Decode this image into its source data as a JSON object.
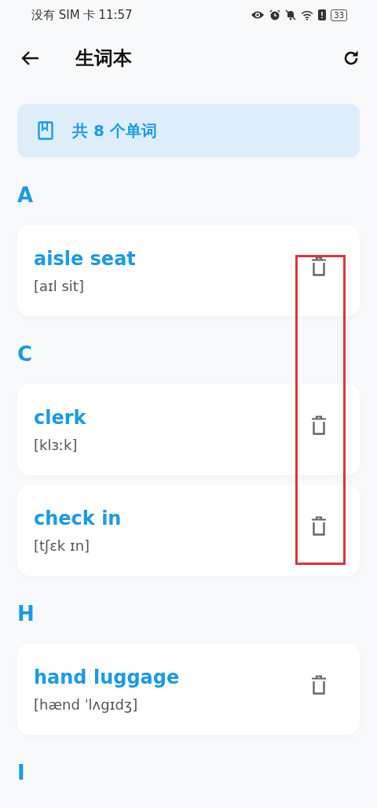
{
  "status_bar": {
    "carrier": "没有 SIM 卡",
    "time": "11:57",
    "battery": "33"
  },
  "header": {
    "title": "生词本"
  },
  "summary": {
    "text": "共 8 个单词"
  },
  "sections": [
    {
      "letter": "A",
      "words": [
        {
          "word": "aisle seat",
          "phonetic": "[aɪl sit]"
        }
      ]
    },
    {
      "letter": "C",
      "words": [
        {
          "word": "clerk",
          "phonetic": "[klɜːk]"
        },
        {
          "word": "check in",
          "phonetic": "[tʃɛk ɪn]"
        }
      ]
    },
    {
      "letter": "H",
      "words": [
        {
          "word": "hand luggage",
          "phonetic": "[hænd ˈlʌgɪdʒ]"
        }
      ]
    },
    {
      "letter": "I"
    }
  ],
  "annotation": {
    "kind": "highlight"
  }
}
